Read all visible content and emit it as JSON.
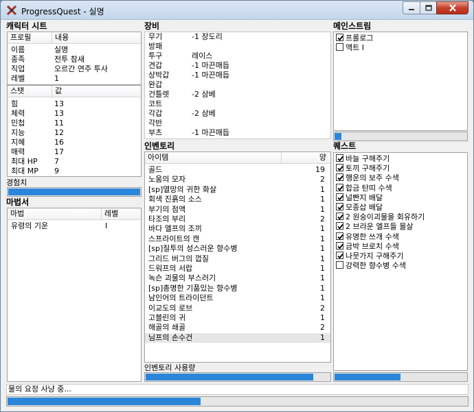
{
  "window": {
    "title": "ProgressQuest - 실명"
  },
  "character": {
    "section_title": "캐릭터 시트",
    "headers": [
      "프로필",
      "내용"
    ],
    "rows": [
      {
        "k": "이름",
        "v": "실명"
      },
      {
        "k": "종족",
        "v": "전투 참새"
      },
      {
        "k": "직업",
        "v": "오르간 연주 투사"
      },
      {
        "k": "레벨",
        "v": "1"
      }
    ]
  },
  "stats": {
    "headers": [
      "스탯",
      "값"
    ],
    "rows": [
      {
        "k": "힘",
        "v": "13"
      },
      {
        "k": "체력",
        "v": "13"
      },
      {
        "k": "민첩",
        "v": "11"
      },
      {
        "k": "지능",
        "v": "12"
      },
      {
        "k": "지혜",
        "v": "16"
      },
      {
        "k": "매력",
        "v": "17"
      },
      {
        "k": "최대 HP",
        "v": "7"
      },
      {
        "k": "최대 MP",
        "v": "9"
      }
    ]
  },
  "experience": {
    "label": "경험치",
    "progress": 1.0
  },
  "spells": {
    "section_title": "마법서",
    "headers": [
      "마법",
      "레벨"
    ],
    "rows": [
      {
        "k": "유령의 기운",
        "v": "I"
      }
    ]
  },
  "equipment": {
    "section_title": "장비",
    "rows": [
      {
        "k": "무기",
        "v": "-1 장도리"
      },
      {
        "k": "방패",
        "v": ""
      },
      {
        "k": "투구",
        "v": "레이스"
      },
      {
        "k": "견갑",
        "v": "-1 마끈매듭"
      },
      {
        "k": "상박갑",
        "v": "-1 마끈매듭"
      },
      {
        "k": "완갑",
        "v": ""
      },
      {
        "k": "건틀렛",
        "v": "-2 삼베"
      },
      {
        "k": "코트",
        "v": ""
      },
      {
        "k": "각갑",
        "v": "-2 삼베"
      },
      {
        "k": "각반",
        "v": ""
      },
      {
        "k": "부츠",
        "v": "-1 마끈매듭"
      }
    ]
  },
  "inventory": {
    "section_title": "인벤토리",
    "headers": [
      "아이템",
      "양"
    ],
    "rows": [
      {
        "k": "골드",
        "v": "19"
      },
      {
        "k": "노움의 모자",
        "v": "2"
      },
      {
        "k": "[sp]열망의 귀한 화살",
        "v": "1"
      },
      {
        "k": "회색 진흙의 소스",
        "v": "1"
      },
      {
        "k": "부기의 점액",
        "v": "1"
      },
      {
        "k": "타조의 부리",
        "v": "2"
      },
      {
        "k": "바다 엘프의 조끼",
        "v": "1"
      },
      {
        "k": "스프라이트의 캔",
        "v": "1"
      },
      {
        "k": "[sp]질투의 성스러운 향수병",
        "v": "1"
      },
      {
        "k": "그리드 버그의 껍질",
        "v": "1"
      },
      {
        "k": "드워프의 서랍",
        "v": "1"
      },
      {
        "k": "녹슨 괴물의 부스러기",
        "v": "1"
      },
      {
        "k": "[sp]총명한 기품있는 향수병",
        "v": "1"
      },
      {
        "k": "남인어의 트라이던트",
        "v": "1"
      },
      {
        "k": "이교도의 로브",
        "v": "2"
      },
      {
        "k": "고블린의 귀",
        "v": "1"
      },
      {
        "k": "해골의 쇄골",
        "v": "2"
      },
      {
        "k": "님프의 손수건",
        "v": "1"
      }
    ],
    "capacity_label": "인벤토리 사용량",
    "capacity_progress": 0.91
  },
  "mainstory": {
    "section_title": "메인스트림",
    "items": [
      {
        "label": "프롤로그",
        "checked": true
      },
      {
        "label": "액트 I",
        "checked": false
      }
    ],
    "progress": 0.05
  },
  "quests": {
    "section_title": "퀘스트",
    "items": [
      {
        "label": "바늘 구해주기",
        "checked": true
      },
      {
        "label": "토끼 구해주기",
        "checked": true
      },
      {
        "label": "행운의 보주 수색",
        "checked": true
      },
      {
        "label": "합금 탄띠 수색",
        "checked": true
      },
      {
        "label": "널빤지 배달",
        "checked": true
      },
      {
        "label": "모종삽 배달",
        "checked": true
      },
      {
        "label": "2 원숭이괴물을 회유하기",
        "checked": true
      },
      {
        "label": "2 브라운 엘프들 몰살",
        "checked": true
      },
      {
        "label": "유명한 쓰개 수색",
        "checked": true
      },
      {
        "label": "금박 브로치 수색",
        "checked": true
      },
      {
        "label": "나뭇가지 구해주기",
        "checked": true
      },
      {
        "label": "강력한 향수병 수색",
        "checked": false
      }
    ],
    "progress": 0.5
  },
  "status": {
    "text": "물의 요정 사냥 중...",
    "progress": 0.42
  }
}
